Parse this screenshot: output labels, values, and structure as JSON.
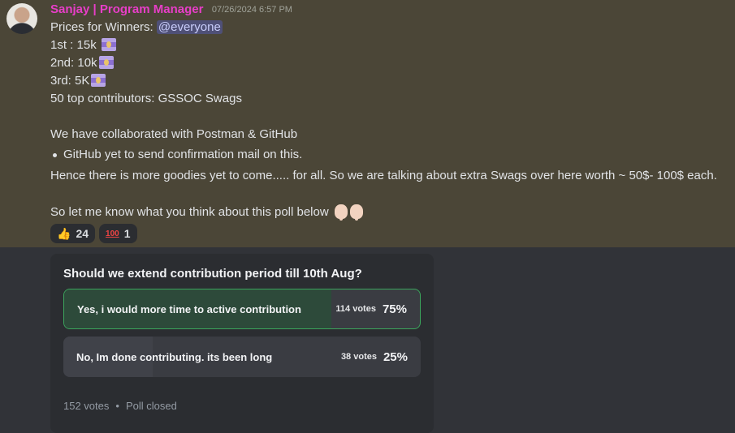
{
  "message": {
    "author": "Sanjay | Program Manager",
    "timestamp": "07/26/2024 6:57 PM",
    "line1_prefix": "Prices for Winners: ",
    "mention": "@everyone",
    "prize1": "1st : 15k",
    "prize2": "2nd: 10k",
    "prize3": "3rd: 5K",
    "prize_top": "50 top contributors: GSSOC Swags",
    "collab": "We have collaborated with Postman & GitHub",
    "bullet": "GitHub yet to send confirmation mail on this.",
    "goodies": "Hence there is more goodies yet to come..... for all. So we are talking about extra Swags over here worth ~ 50$-  100$ each.",
    "poll_intro": "So let me know what you think about this poll below",
    "emoji_prize": "money-with-wings-icon",
    "emoji_point": "point-down-icon"
  },
  "reactions": [
    {
      "icon": "thumbs-up-icon",
      "glyph": "👍",
      "count": "24"
    },
    {
      "icon": "hundred-points-icon",
      "glyph": "100",
      "count": "1"
    }
  ],
  "poll": {
    "question": "Should we extend contribution period till 10th Aug?",
    "answers": [
      {
        "label": "Yes, i would more time to active contribution",
        "votes": "114 votes",
        "percent": "75%",
        "fraction": 0.75,
        "selected": true
      },
      {
        "label": "No, Im done contributing. its been long",
        "votes": "38 votes",
        "percent": "25%",
        "fraction": 0.25,
        "selected": false
      }
    ],
    "total": "152 votes",
    "separator": "•",
    "status": "Poll closed"
  },
  "colors": {
    "highlight_bg": "#4b4637",
    "author": "#e83ec8",
    "selected_border": "#3ba55c",
    "selected_fill": "#2d4a3a"
  }
}
